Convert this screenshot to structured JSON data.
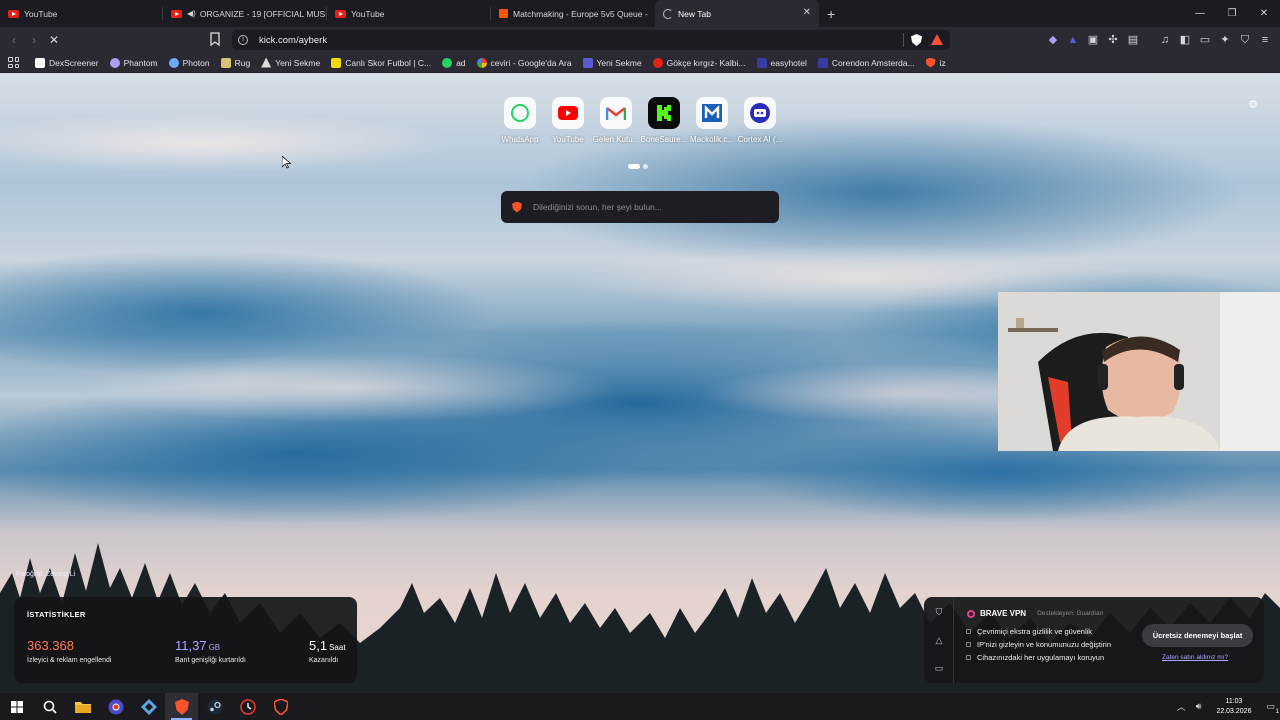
{
  "tabs": [
    {
      "label": "YouTube",
      "icon": "youtube-icon",
      "active": false
    },
    {
      "label": "ORGANIZE - 19 [OFFICIAL MUSIC",
      "icon": "youtube-icon",
      "audio": true,
      "active": false
    },
    {
      "label": "YouTube",
      "icon": "youtube-icon",
      "active": false
    },
    {
      "label": "Matchmaking - Europe 5v5 Queue -",
      "icon": "faceit-icon",
      "active": false
    },
    {
      "label": "New Tab",
      "icon": "loading-spinner-icon",
      "active": true
    }
  ],
  "address_bar": {
    "url": "kick.com/ayberk"
  },
  "bookmarks": [
    {
      "label": "DexScreener",
      "color": "#ffffff"
    },
    {
      "label": "Phantom",
      "color": "#ab9ff2"
    },
    {
      "label": "Photon",
      "color": "#6ea8ff"
    },
    {
      "label": "Rug",
      "color": "#d8c27a"
    },
    {
      "label": "Yeni Sekme",
      "color": "#ffffff"
    },
    {
      "label": "Canlı Skor Futbol | C...",
      "color": "#f5d90a"
    },
    {
      "label": "ad",
      "color": "#25d366"
    },
    {
      "label": "ceviri - Google'da Ara",
      "color": "#ffffff"
    },
    {
      "label": "Yeni Sekme",
      "color": "#5b5bd6"
    },
    {
      "label": "Gökçe kırgız- Kalbi...",
      "color": "#e62117"
    },
    {
      "label": "easyhotel",
      "color": "#3a3aa0"
    },
    {
      "label": "Corendon Amsterda...",
      "color": "#3a3aa0"
    },
    {
      "label": "iz",
      "color": "#fb542b"
    }
  ],
  "top_sites": [
    {
      "label": "WhatsApp",
      "icon": "whatsapp-icon"
    },
    {
      "label": "YouTube",
      "icon": "youtube-icon"
    },
    {
      "label": "Gelen Kutu...",
      "icon": "gmail-icon"
    },
    {
      "label": "BoneSaure...",
      "icon": "kick-icon"
    },
    {
      "label": "Mackolik.c...",
      "icon": "mackolik-icon"
    },
    {
      "label": "Cortex AI (...",
      "icon": "cortex-icon"
    }
  ],
  "search": {
    "placeholder": "Dilediğinizi sorun, her şeyi bulun..."
  },
  "photo_credit": "Fotoğraf: Zetong Li",
  "stats": {
    "title": "İSTATİSTİKLER",
    "blocked": {
      "value": "363.368",
      "desc": "İzleyici & reklam engellendi",
      "color": "#ff7a59"
    },
    "bandwidth": {
      "value": "11,37",
      "unit": "GB",
      "desc": "Bant genişliği kurtarıldı",
      "color": "#a9a9ff"
    },
    "time": {
      "value": "5,1",
      "unit": "Saat",
      "desc": "Kazanıldı",
      "color": "#ffffff"
    }
  },
  "vpn": {
    "name": "BRAVE VPN",
    "sponsor": "Destekleyen:  Guardian",
    "features": [
      "Çevrimiçi ekstra gizlilik ve güvenlik",
      "IP'nizi gizleyin ve konumunuzu değiştirin",
      "Cihazınızdaki her uygulamayı koruyun"
    ],
    "cta": "Ücretsiz denemeyi başlat",
    "already": "Zaten satın aldınız mı?"
  },
  "clock": {
    "time": "11:03",
    "date": "22.03.2026"
  },
  "notification_count": "1"
}
